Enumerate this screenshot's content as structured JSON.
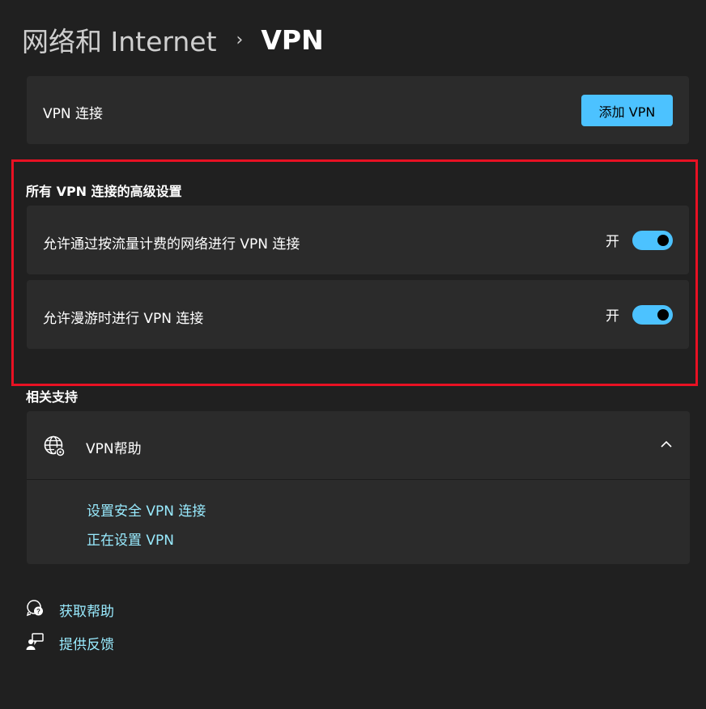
{
  "breadcrumb": {
    "parent": "网络和 Internet",
    "separator": "›",
    "current": "VPN"
  },
  "vpn_card": {
    "label": "VPN 连接",
    "add_button": "添加 VPN"
  },
  "advanced": {
    "title": "所有 VPN 连接的高级设置",
    "items": [
      {
        "label": "允许通过按流量计费的网络进行 VPN 连接",
        "state": "开",
        "on": true
      },
      {
        "label": "允许漫游时进行 VPN 连接",
        "state": "开",
        "on": true
      }
    ]
  },
  "related": {
    "title": "相关支持",
    "help": {
      "title": "VPN帮助",
      "links": [
        "设置安全 VPN 连接",
        "正在设置 VPN"
      ]
    }
  },
  "footer": {
    "get_help": "获取帮助",
    "feedback": "提供反馈"
  },
  "colors": {
    "accent": "#4cc2ff",
    "link": "#99ebff",
    "highlight": "#e81123",
    "card": "#2b2b2b",
    "background": "#202020"
  }
}
